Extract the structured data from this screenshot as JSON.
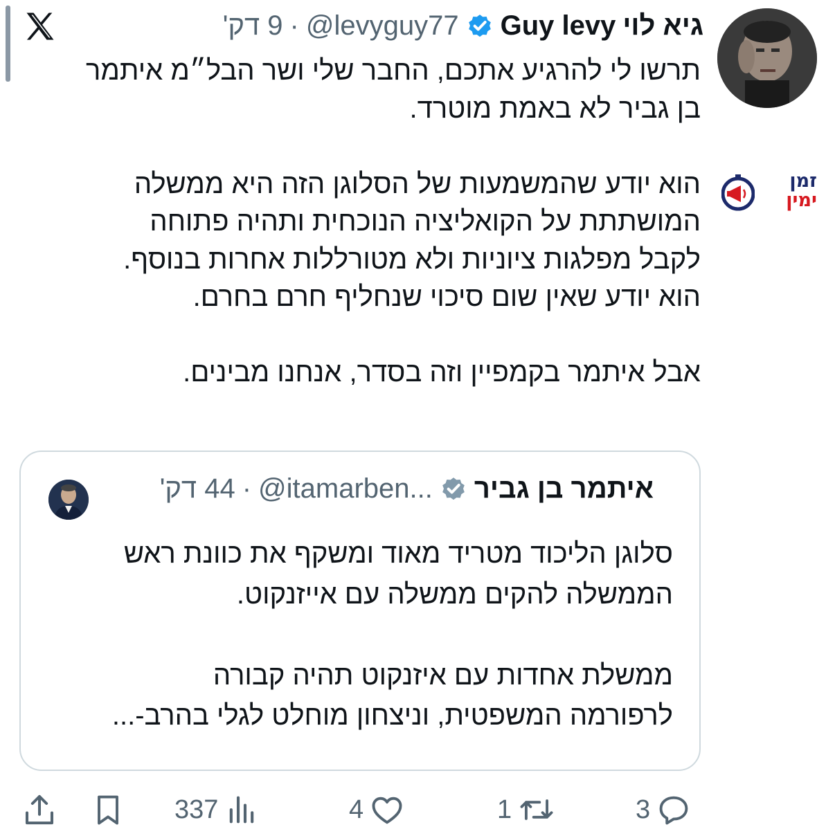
{
  "author": {
    "name_he": "גיא לוי",
    "name_en": "Guy levy",
    "handle": "@levyguy77",
    "separator": "·",
    "time": "9 דק'"
  },
  "brand_logo": {
    "line1": "זמן",
    "line2": "ימין"
  },
  "tweet": {
    "text": "תרשו לי להרגיע אתכם, החבר שלי ושר הבל״מ איתמר\nבן גביר לא באמת מוטרד.\n\nהוא יודע שהמשמעות של הסלוגן הזה היא ממשלה\nהמושתתת על הקואליציה הנוכחית ותהיה פתוחה\nלקבל מפלגות ציוניות ולא מטורללות אחרות בנוסף.\nהוא יודע שאין שום סיכוי שנחליף חרם בחרם.\n\nאבל איתמר בקמפיין וזה בסדר, אנחנו מבינים."
  },
  "quote": {
    "name": "איתמר בן גביר",
    "handle": "@itamarben...",
    "separator": "·",
    "time": "44 דק'",
    "text": "סלוגן הליכוד מטריד מאוד ומשקף את כוונת ראש\nהממשלה להקים ממשלה עם אייזנקוט.\n\nממשלת אחדות עם איזנקוט תהיה קבורה\nלרפורמה המשפטית, וניצחון מוחלט לגלי בהרב-..."
  },
  "actions": {
    "replies": "3",
    "reposts": "1",
    "likes": "4",
    "views": "337"
  },
  "colors": {
    "text": "#0f1419",
    "secondary": "#536471",
    "verified": "#1d9bf0",
    "border": "#cfd9de",
    "brand_red": "#d71920",
    "brand_navy": "#1c2a6b"
  }
}
